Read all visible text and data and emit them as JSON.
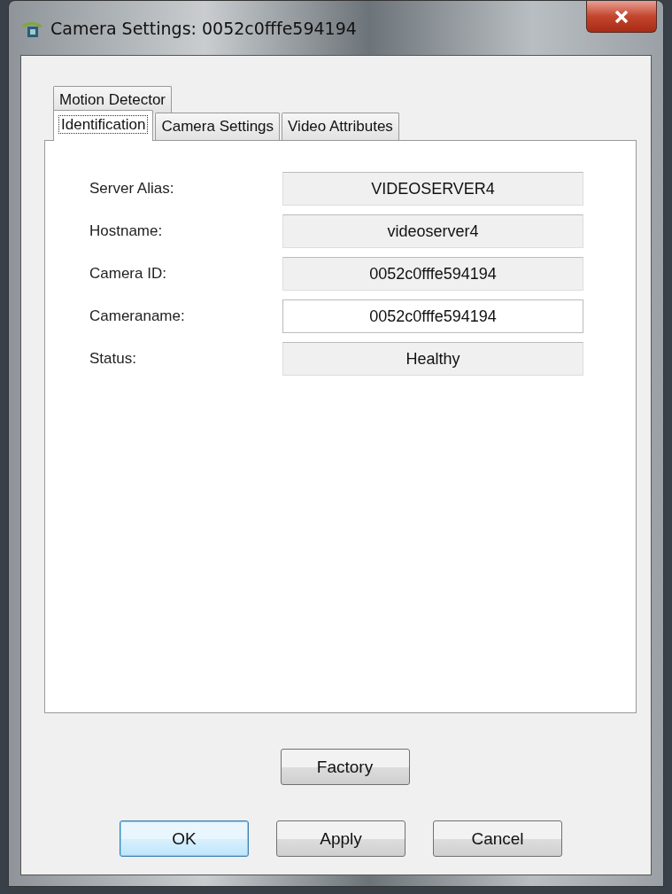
{
  "window": {
    "title": "Camera Settings: 0052c0fffe594194"
  },
  "tab_rows": [
    [
      {
        "label": "Motion Detector",
        "selected": false
      }
    ],
    [
      {
        "label": "Identification",
        "selected": true
      },
      {
        "label": "Camera Settings",
        "selected": false
      },
      {
        "label": "Video Attributes",
        "selected": false
      }
    ]
  ],
  "fields": [
    {
      "label": "Server Alias:",
      "value": "VIDEOSERVER4",
      "editable": false
    },
    {
      "label": "Hostname:",
      "value": "videoserver4",
      "editable": false
    },
    {
      "label": "Camera ID:",
      "value": "0052c0fffe594194",
      "editable": false
    },
    {
      "label": "Cameraname:",
      "value": "0052c0fffe594194",
      "editable": true
    },
    {
      "label": "Status:",
      "value": "Healthy",
      "editable": false
    }
  ],
  "factory_button": {
    "label": "Factory",
    "default": false
  },
  "buttons": [
    {
      "label": "OK",
      "default": true
    },
    {
      "label": "Apply",
      "default": false
    },
    {
      "label": "Cancel",
      "default": false
    }
  ]
}
